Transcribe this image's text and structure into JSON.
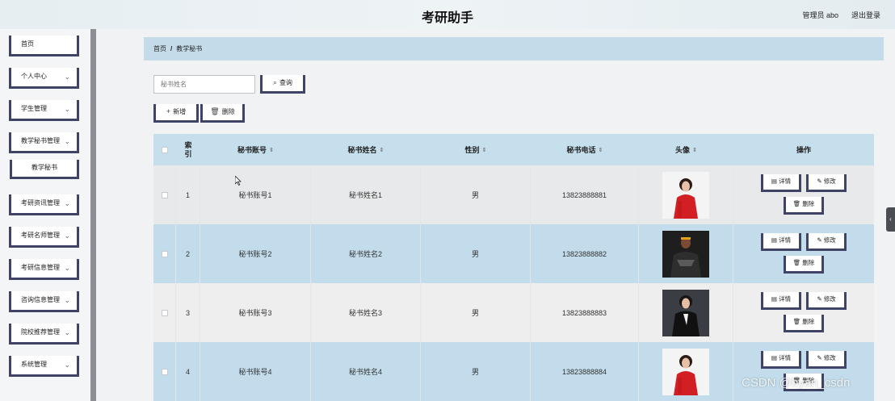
{
  "app": {
    "title": "考研助手"
  },
  "header": {
    "user": "管理员 abo",
    "logout": "退出登录"
  },
  "sidebar": {
    "items": [
      {
        "label": "首页",
        "expandable": false
      },
      {
        "label": "个人中心",
        "expandable": true
      },
      {
        "label": "学生管理",
        "expandable": true
      },
      {
        "label": "教学秘书管理",
        "expandable": true
      },
      {
        "label": "考研资讯管理",
        "expandable": true
      },
      {
        "label": "考研名师管理",
        "expandable": true
      },
      {
        "label": "考研信息管理",
        "expandable": true
      },
      {
        "label": "咨询信息管理",
        "expandable": true
      },
      {
        "label": "院校推荐管理",
        "expandable": true
      },
      {
        "label": "系统管理",
        "expandable": true
      }
    ],
    "subitem": "教学秘书"
  },
  "breadcrumb": {
    "home": "首页",
    "sep": "/",
    "current": "教学秘书"
  },
  "search": {
    "placeholder": "秘书姓名",
    "button": "查询"
  },
  "actions": {
    "add": "新增",
    "delete": "删除"
  },
  "table": {
    "columns": [
      "索\n引",
      "秘书账号",
      "秘书姓名",
      "性别",
      "秘书电话",
      "头像",
      "操作"
    ],
    "col_index": "索",
    "col_index2": "引",
    "col_account": "秘书账号",
    "col_name": "秘书姓名",
    "col_gender": "性别",
    "col_phone": "秘书电话",
    "col_avatar": "头像",
    "col_ops": "操作",
    "rows": [
      {
        "index": "1",
        "account": "秘书账号1",
        "name": "秘书姓名1",
        "gender": "男",
        "phone": "13823888881",
        "avatar": "woman-red-dress"
      },
      {
        "index": "2",
        "account": "秘书账号2",
        "name": "秘书姓名2",
        "gender": "男",
        "phone": "13823888882",
        "avatar": "man-dark-suit"
      },
      {
        "index": "3",
        "account": "秘书账号3",
        "name": "秘书姓名3",
        "gender": "男",
        "phone": "13823888883",
        "avatar": "woman-black-suit"
      },
      {
        "index": "4",
        "account": "秘书账号4",
        "name": "秘书姓名4",
        "gender": "男",
        "phone": "13823888884",
        "avatar": "woman-red-dress"
      }
    ],
    "op_detail": "详情",
    "op_edit": "修改",
    "op_delete": "删除"
  },
  "watermark": "CSDN @byan_csdn",
  "colors": {
    "accent_border": "#3f4366",
    "header_row": "#c6dfec",
    "row_alt": "#c2dceb",
    "row_gray": "#e8e9ea"
  }
}
